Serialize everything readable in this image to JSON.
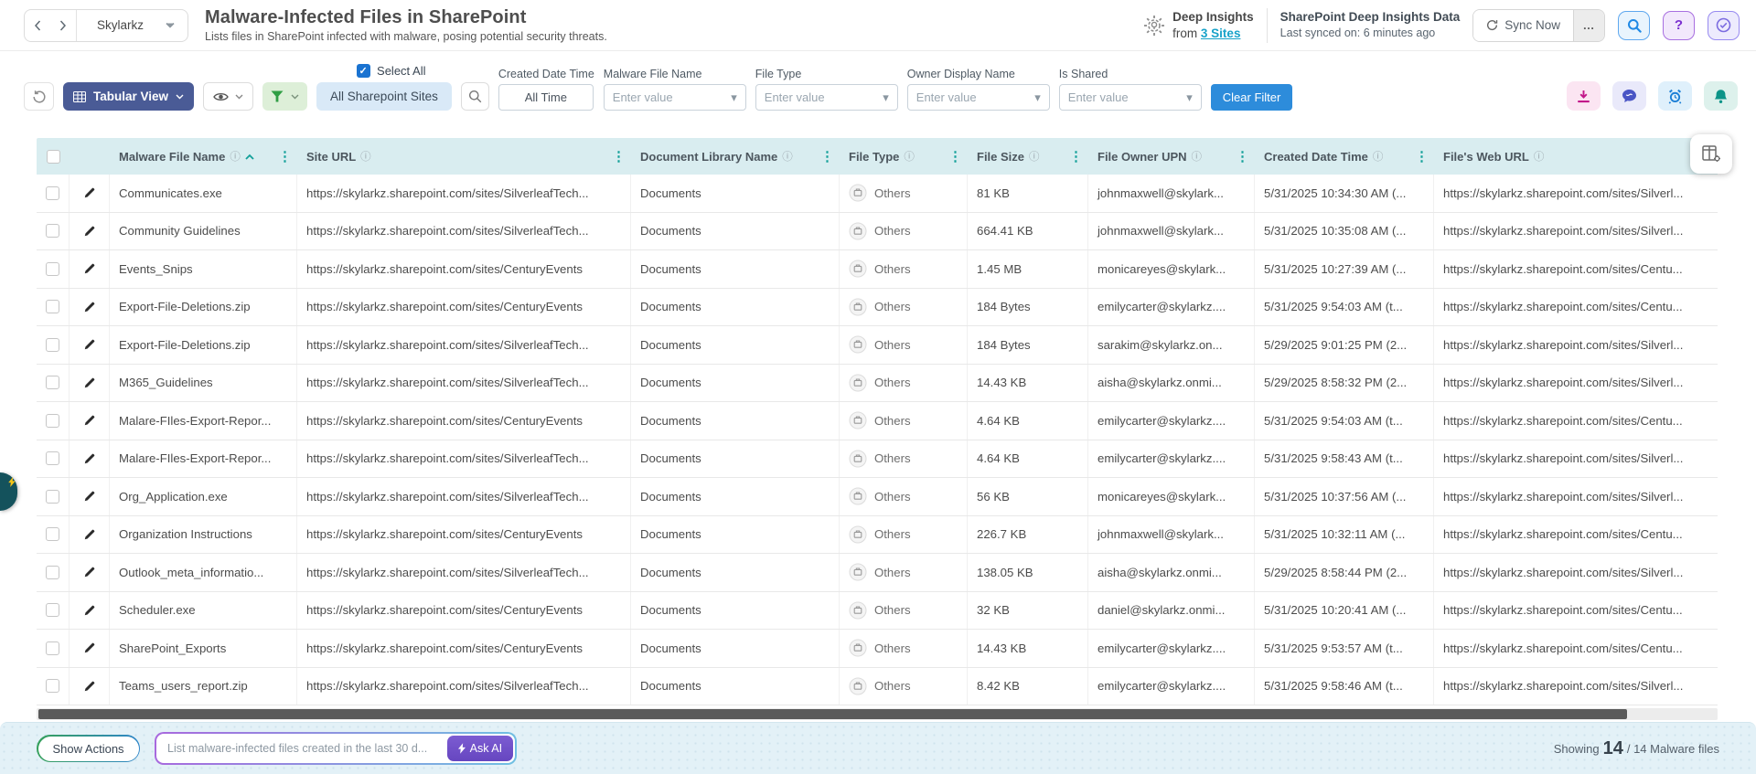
{
  "header": {
    "org_selector": "Skylarkz",
    "title": "Malware-Infected Files in SharePoint",
    "subtitle": "Lists files in SharePoint infected with malware, posing potential security threats.",
    "deep_insights_label": "Deep Insights",
    "deep_insights_from": "from",
    "deep_insights_sites_link": "3 Sites",
    "sync_title": "SharePoint Deep Insights Data",
    "sync_subtitle": "Last synced on: 6 minutes ago",
    "sync_button": "Sync Now",
    "more_button": "…"
  },
  "toolbar": {
    "view_button": "Tabular View",
    "select_all": "Select All",
    "sites_pill": "All Sharepoint Sites",
    "filters": [
      {
        "label": "Created Date Time",
        "value": "All Time"
      },
      {
        "label": "Malware File Name",
        "placeholder": "Enter value"
      },
      {
        "label": "File Type",
        "placeholder": "Enter value"
      },
      {
        "label": "Owner Display Name",
        "placeholder": "Enter value"
      },
      {
        "label": "Is Shared",
        "placeholder": "Enter value"
      }
    ],
    "clear_filter": "Clear Filter"
  },
  "table": {
    "columns": [
      {
        "label": "Malware File Name",
        "sorted": "asc"
      },
      {
        "label": "Site URL"
      },
      {
        "label": "Document Library Name"
      },
      {
        "label": "File Type"
      },
      {
        "label": "File Size"
      },
      {
        "label": "File Owner UPN"
      },
      {
        "label": "Created Date Time"
      },
      {
        "label": "File's Web URL"
      }
    ],
    "rows": [
      {
        "name": "Communicates.exe",
        "site_url": "https://skylarkz.sharepoint.com/sites/SilverleafTech...",
        "library": "Documents",
        "file_type": "Others",
        "file_size": "81 KB",
        "owner": "johnmaxwell@skylark...",
        "created": "5/31/2025 10:34:30 AM (...",
        "web_url": "https://skylarkz.sharepoint.com/sites/Silverl..."
      },
      {
        "name": "Community Guidelines",
        "site_url": "https://skylarkz.sharepoint.com/sites/SilverleafTech...",
        "library": "Documents",
        "file_type": "Others",
        "file_size": "664.41 KB",
        "owner": "johnmaxwell@skylark...",
        "created": "5/31/2025 10:35:08 AM (...",
        "web_url": "https://skylarkz.sharepoint.com/sites/Silverl..."
      },
      {
        "name": "Events_Snips",
        "site_url": "https://skylarkz.sharepoint.com/sites/CenturyEvents",
        "library": "Documents",
        "file_type": "Others",
        "file_size": "1.45 MB",
        "owner": "monicareyes@skylark...",
        "created": "5/31/2025 10:27:39 AM (...",
        "web_url": "https://skylarkz.sharepoint.com/sites/Centu..."
      },
      {
        "name": "Export-File-Deletions.zip",
        "site_url": "https://skylarkz.sharepoint.com/sites/CenturyEvents",
        "library": "Documents",
        "file_type": "Others",
        "file_size": "184 Bytes",
        "owner": "emilycarter@skylarkz....",
        "created": "5/31/2025 9:54:03 AM (t...",
        "web_url": "https://skylarkz.sharepoint.com/sites/Centu..."
      },
      {
        "name": "Export-File-Deletions.zip",
        "site_url": "https://skylarkz.sharepoint.com/sites/SilverleafTech...",
        "library": "Documents",
        "file_type": "Others",
        "file_size": "184 Bytes",
        "owner": "sarakim@skylarkz.on...",
        "created": "5/29/2025 9:01:25 PM (2...",
        "web_url": "https://skylarkz.sharepoint.com/sites/Silverl..."
      },
      {
        "name": "M365_Guidelines",
        "site_url": "https://skylarkz.sharepoint.com/sites/SilverleafTech...",
        "library": "Documents",
        "file_type": "Others",
        "file_size": "14.43 KB",
        "owner": "aisha@skylarkz.onmi...",
        "created": "5/29/2025 8:58:32 PM (2...",
        "web_url": "https://skylarkz.sharepoint.com/sites/Silverl..."
      },
      {
        "name": "Malare-FIles-Export-Repor...",
        "site_url": "https://skylarkz.sharepoint.com/sites/CenturyEvents",
        "library": "Documents",
        "file_type": "Others",
        "file_size": "4.64 KB",
        "owner": "emilycarter@skylarkz....",
        "created": "5/31/2025 9:54:03 AM (t...",
        "web_url": "https://skylarkz.sharepoint.com/sites/Centu..."
      },
      {
        "name": "Malare-FIles-Export-Repor...",
        "site_url": "https://skylarkz.sharepoint.com/sites/SilverleafTech...",
        "library": "Documents",
        "file_type": "Others",
        "file_size": "4.64 KB",
        "owner": "emilycarter@skylarkz....",
        "created": "5/31/2025 9:58:43 AM (t...",
        "web_url": "https://skylarkz.sharepoint.com/sites/Silverl..."
      },
      {
        "name": "Org_Application.exe",
        "site_url": "https://skylarkz.sharepoint.com/sites/SilverleafTech...",
        "library": "Documents",
        "file_type": "Others",
        "file_size": "56 KB",
        "owner": "monicareyes@skylark...",
        "created": "5/31/2025 10:37:56 AM (...",
        "web_url": "https://skylarkz.sharepoint.com/sites/Silverl..."
      },
      {
        "name": "Organization Instructions",
        "site_url": "https://skylarkz.sharepoint.com/sites/CenturyEvents",
        "library": "Documents",
        "file_type": "Others",
        "file_size": "226.7 KB",
        "owner": "johnmaxwell@skylark...",
        "created": "5/31/2025 10:32:11 AM (...",
        "web_url": "https://skylarkz.sharepoint.com/sites/Centu..."
      },
      {
        "name": "Outlook_meta_informatio...",
        "site_url": "https://skylarkz.sharepoint.com/sites/SilverleafTech...",
        "library": "Documents",
        "file_type": "Others",
        "file_size": "138.05 KB",
        "owner": "aisha@skylarkz.onmi...",
        "created": "5/29/2025 8:58:44 PM (2...",
        "web_url": "https://skylarkz.sharepoint.com/sites/Silverl..."
      },
      {
        "name": "Scheduler.exe",
        "site_url": "https://skylarkz.sharepoint.com/sites/CenturyEvents",
        "library": "Documents",
        "file_type": "Others",
        "file_size": "32 KB",
        "owner": "daniel@skylarkz.onmi...",
        "created": "5/31/2025 10:20:41 AM (...",
        "web_url": "https://skylarkz.sharepoint.com/sites/Centu..."
      },
      {
        "name": "SharePoint_Exports",
        "site_url": "https://skylarkz.sharepoint.com/sites/CenturyEvents",
        "library": "Documents",
        "file_type": "Others",
        "file_size": "14.43 KB",
        "owner": "emilycarter@skylarkz....",
        "created": "5/31/2025 9:53:57 AM (t...",
        "web_url": "https://skylarkz.sharepoint.com/sites/Centu..."
      },
      {
        "name": "Teams_users_report.zip",
        "site_url": "https://skylarkz.sharepoint.com/sites/SilverleafTech...",
        "library": "Documents",
        "file_type": "Others",
        "file_size": "8.42 KB",
        "owner": "emilycarter@skylarkz....",
        "created": "5/31/2025 9:58:46 AM (t...",
        "web_url": "https://skylarkz.sharepoint.com/sites/Silverl..."
      }
    ]
  },
  "footer": {
    "show_actions": "Show Actions",
    "ask_ai_placeholder": "List malware-infected files created in the last 30 d...",
    "ask_ai_button": "Ask AI",
    "showing_label": "Showing",
    "showing_count": "14",
    "showing_rest": "/ 14 Malware files"
  },
  "colors": {
    "accent_teal": "#13a099",
    "table_header_bg": "#d9edf0",
    "view_button_blue": "#4a5b96",
    "clear_filter_blue": "#2d8cdb",
    "ask_ai_purple": "#6d4ec2",
    "link_cyan": "#17a2c9",
    "filter_green": "#2f9e44",
    "select_all_blue": "#1a73d1"
  }
}
